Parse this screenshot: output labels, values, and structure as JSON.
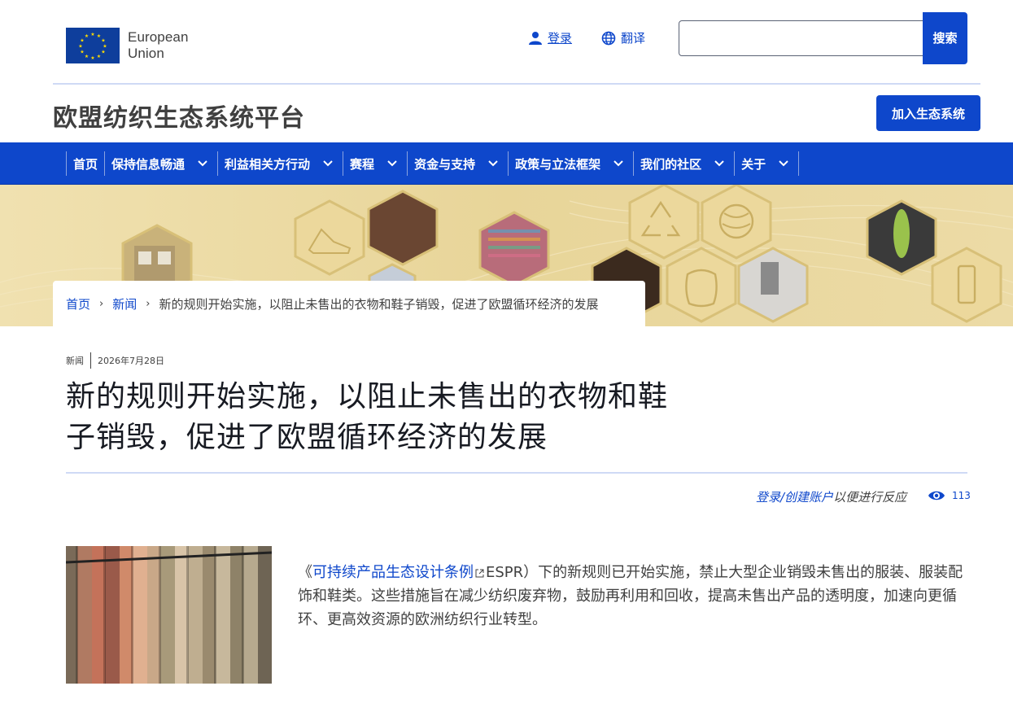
{
  "header": {
    "logo_line1": "European",
    "logo_line2": "Union",
    "login_label": "登录",
    "translate_label": "翻译",
    "search_value": "",
    "search_button": "搜索"
  },
  "platform": {
    "title": "欧盟纺织生态系统平台",
    "join_button": "加入生态系统"
  },
  "nav": {
    "items": [
      {
        "label": "首页"
      },
      {
        "label": "保持信息畅通"
      },
      {
        "label": "利益相关方行动"
      },
      {
        "label": "赛程"
      },
      {
        "label": "资金与支持"
      },
      {
        "label": "政策与立法框架"
      },
      {
        "label": "我们的社区"
      },
      {
        "label": "关于"
      }
    ]
  },
  "breadcrumb": {
    "home": "首页",
    "news": "新闻",
    "sep": "›",
    "current": "新的规则开始实施，以阻止未售出的衣物和鞋子销毁，促进了欧盟循环经济的发展"
  },
  "article": {
    "type": "新闻",
    "date": "2026年7月28日",
    "title_line1": "新的规则开始实施，以阻止未售出的衣物和鞋",
    "title_line2": "子销毁，促进了欧盟循环经济的发展",
    "reaction_link": "登录/创建账户",
    "reaction_text": "以便进行反应",
    "views": "113",
    "intro_pre": "《",
    "intro_link": "可持续产品生态设计条例",
    "intro_rest": "ESPR）下的新规则已开始实施，禁止大型企业销毁未售出的服装、服装配饰和鞋类。这些措施旨在减少纺织废弃物，鼓励再利用和回收，提高未售出产品的透明度，加速向更循环、更高效资源的欧洲纺织行业转型。"
  },
  "colors": {
    "primary": "#0e47cb",
    "banner": "#ead8a0",
    "text": "#404040"
  },
  "icons": {
    "login": "user-icon",
    "translate": "globe-icon",
    "nav_dropdown": "chevron-down-icon",
    "views": "eye-icon",
    "external": "external-link-icon"
  }
}
